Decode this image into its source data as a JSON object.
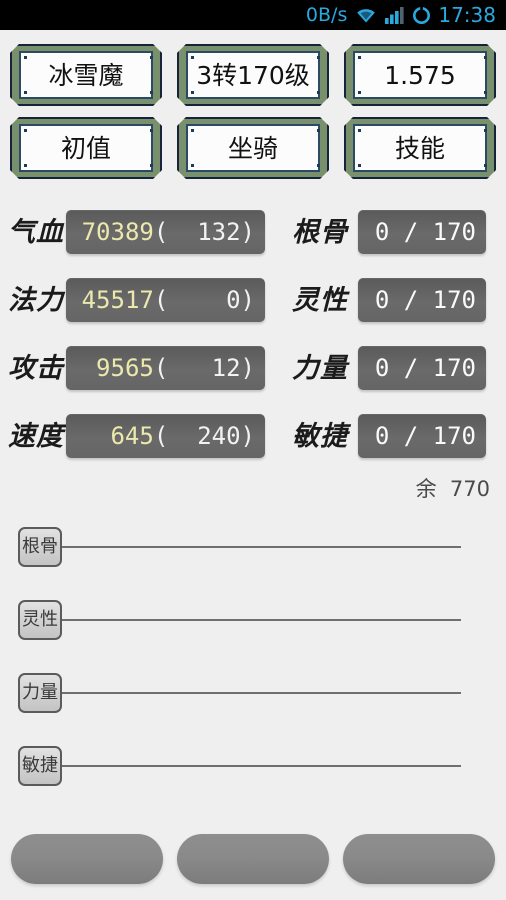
{
  "statusbar": {
    "network_speed": "0B/s",
    "wifi_icon": "wifi-icon",
    "signal_icon": "signal-bars-icon",
    "circle_icon": "circle-icon",
    "clock": "17:38",
    "accent_color": "#2aa9e0",
    "background": "#000000"
  },
  "header": {
    "buttons": [
      {
        "label": "冰雪魔",
        "name": "character-name-button"
      },
      {
        "label": "3转170级",
        "name": "level-button"
      },
      {
        "label": "1.575",
        "name": "version-button"
      },
      {
        "label": "初值",
        "name": "base-value-button"
      },
      {
        "label": "坐骑",
        "name": "mount-button"
      },
      {
        "label": "技能",
        "name": "skill-button"
      }
    ],
    "frame_color": "#78906c",
    "border_color": "#16233a",
    "panel_color": "#fcfcfc"
  },
  "stats": {
    "rows": [
      {
        "left": {
          "label": "气血",
          "value": "70389",
          "bonus": "(  132)"
        },
        "right": {
          "label": "根骨",
          "value": "0 / 170"
        }
      },
      {
        "left": {
          "label": "法力",
          "value": "45517",
          "bonus": "(    0)"
        },
        "right": {
          "label": "灵性",
          "value": "0 / 170"
        }
      },
      {
        "left": {
          "label": "攻击",
          "value": "9565",
          "bonus": "(   12)"
        },
        "right": {
          "label": "力量",
          "value": "0 / 170"
        }
      },
      {
        "left": {
          "label": "速度",
          "value": "645",
          "bonus": "(  240)"
        },
        "right": {
          "label": "敏捷",
          "value": "0 / 170"
        }
      }
    ],
    "value_color": "#ece8ae",
    "box_color": "#656565"
  },
  "remaining": {
    "text": "余  770",
    "label": "余",
    "amount": "770"
  },
  "sliders": [
    {
      "label": "根骨",
      "name": "slider-genggu",
      "position_percent": 0
    },
    {
      "label": "灵性",
      "name": "slider-lingxing",
      "position_percent": 0
    },
    {
      "label": "力量",
      "name": "slider-liliang",
      "position_percent": 0
    },
    {
      "label": "敏捷",
      "name": "slider-minjie",
      "position_percent": 0
    }
  ],
  "bottom_buttons": [
    {
      "label": "",
      "name": "bottom-button-1"
    },
    {
      "label": "",
      "name": "bottom-button-2"
    },
    {
      "label": "",
      "name": "bottom-button-3"
    }
  ]
}
